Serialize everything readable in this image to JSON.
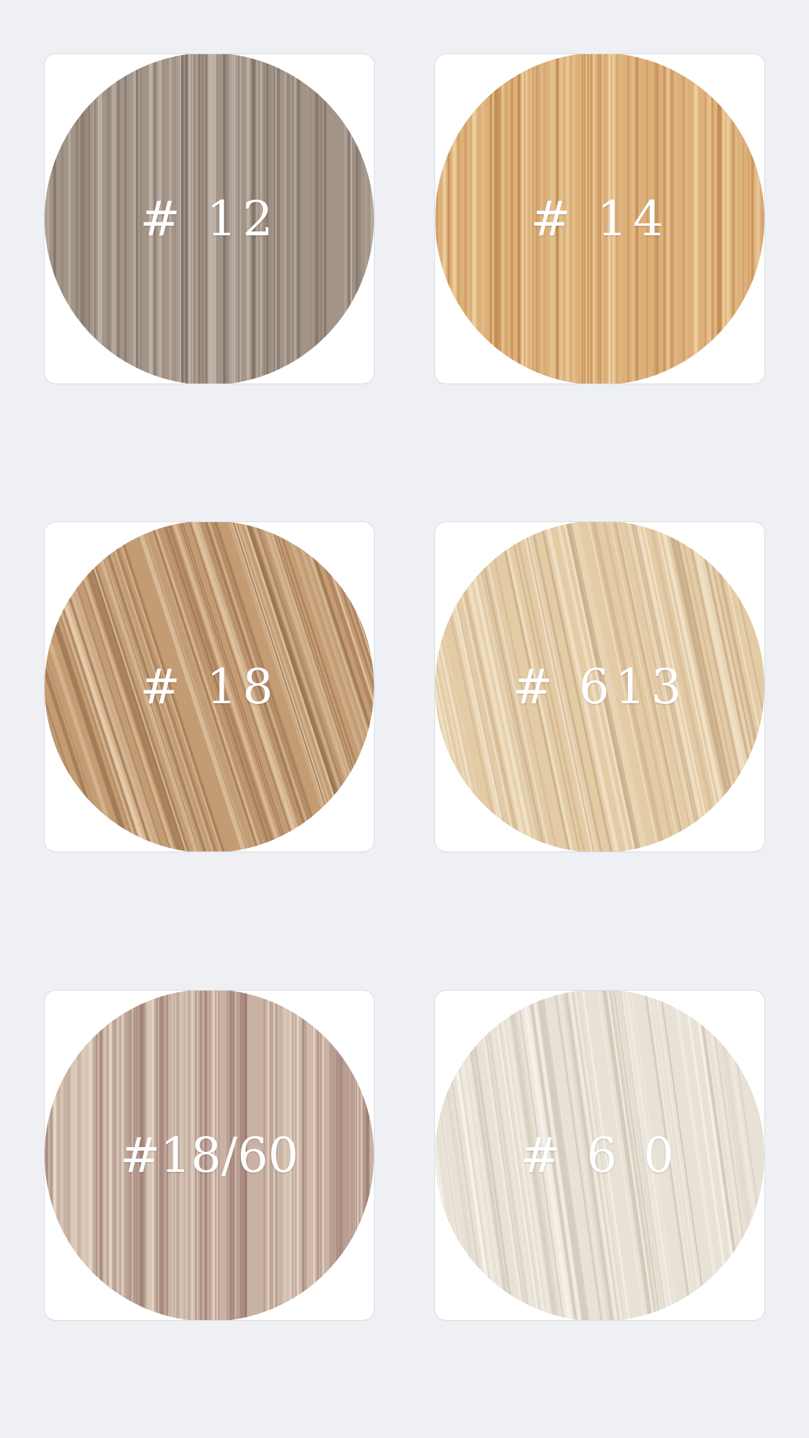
{
  "swatches": [
    {
      "label": "# 12",
      "base": "#a39488",
      "light": "#c6bbb1",
      "dark": "#7e7066",
      "angle": 0
    },
    {
      "label": "# 14",
      "base": "#ddb07a",
      "light": "#f0d3a4",
      "dark": "#c08a52",
      "angle": 0
    },
    {
      "label": "# 18",
      "base": "#c39c74",
      "light": "#e6cfae",
      "dark": "#9c7350",
      "angle": 18
    },
    {
      "label": "# 613",
      "base": "#e3cba6",
      "light": "#f3e6cd",
      "dark": "#c6a985",
      "angle": 12
    },
    {
      "label": "#18/60",
      "base": "#c9b2a4",
      "light": "#ece0cf",
      "dark": "#9c7c72",
      "angle": 0
    },
    {
      "label": "# 6 0",
      "base": "#e8e1d6",
      "light": "#f7f3ec",
      "dark": "#cfc6b7",
      "angle": 8
    }
  ]
}
